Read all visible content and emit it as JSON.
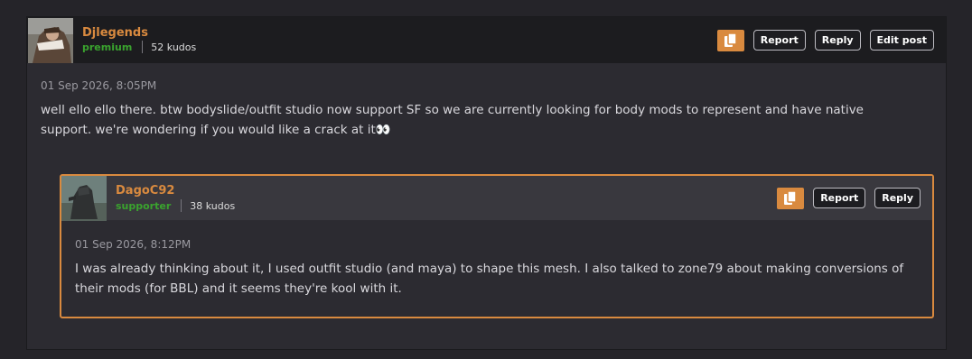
{
  "post": {
    "author": "Djlegends",
    "role": "premium",
    "kudos": "52 kudos",
    "timestamp": "01 Sep 2026, 8:05PM",
    "body": "well ello ello there. btw bodyslide/outfit studio now support SF so we are currently looking for body mods to represent and have native support. we're wondering if you would like a crack at it👀",
    "actions": {
      "report": "Report",
      "reply": "Reply",
      "edit": "Edit post"
    }
  },
  "reply": {
    "author": "DagoC92",
    "role": "supporter",
    "kudos": "38 kudos",
    "timestamp": "01 Sep 2026, 8:12PM",
    "body": "I was already thinking about it, I used outfit studio (and maya) to shape this mesh. I also talked to zone79 about making conversions of their mods (for BBL) and it seems they're kool with it.",
    "actions": {
      "report": "Report",
      "reply": "Reply"
    }
  },
  "colors": {
    "accent": "#d98a3f",
    "role_green": "#3aa32e"
  },
  "icons": {
    "copy": "copy-icon"
  }
}
